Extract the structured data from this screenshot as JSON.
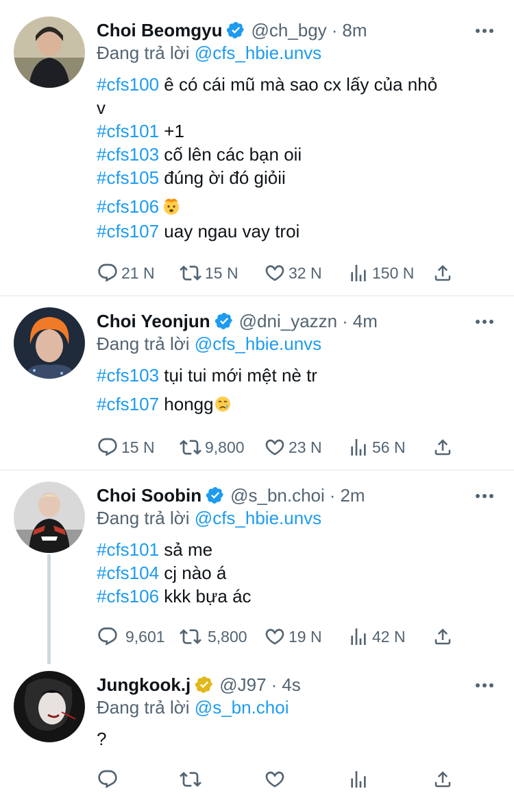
{
  "tweets": [
    {
      "name": "Choi Beomgyu",
      "handle": "@ch_bgy",
      "dot": "·",
      "time": "8m",
      "badge_color": "#1d9bf0",
      "reply_prefix": "Đang trả lời",
      "reply_mention": "@cfs_hbie.unvs",
      "lines": [
        {
          "tag": "#cfs100",
          "text": " ê có cái mũ mà sao cx lấy của nhỏ"
        },
        {
          "tag": "",
          "text": "v"
        },
        {
          "tag": "#cfs101",
          "text": " +1"
        },
        {
          "tag": "#cfs103",
          "text": " cố lên các bạn oii"
        },
        {
          "tag": "#cfs105",
          "text": " đúng ời đó giỏii"
        },
        {
          "tag": "#cfs106",
          "text": "",
          "emoji": "exploding-head-emoji"
        },
        {
          "tag": "#cfs107",
          "text": " uay ngau vay troi"
        }
      ],
      "counts": {
        "reply": "21 N",
        "retweet": "15 N",
        "like": "32 N",
        "views": "150 N"
      }
    },
    {
      "name": "Choi Yeonjun",
      "handle": "@dni_yazzn",
      "dot": "·",
      "time": "4m",
      "badge_color": "#1d9bf0",
      "reply_prefix": "Đang trả lời",
      "reply_mention": "@cfs_hbie.unvs",
      "lines": [
        {
          "tag": "#cfs103",
          "text": " tụi tui mới mệt nè tr"
        },
        {
          "tag": "#cfs107",
          "text": " hongg",
          "emoji": "crying-face-emoji"
        }
      ],
      "counts": {
        "reply": "15 N",
        "retweet": "9,800",
        "like": "23 N",
        "views": "56 N"
      }
    },
    {
      "name": "Choi Soobin",
      "handle": "@s_bn.choi",
      "dot": "·",
      "time": "2m",
      "badge_color": "#1d9bf0",
      "reply_prefix": "Đang trả lời",
      "reply_mention": "@cfs_hbie.unvs",
      "lines": [
        {
          "tag": "#cfs101",
          "text": " sả me"
        },
        {
          "tag": "#cfs104",
          "text": " cj nào á"
        },
        {
          "tag": "#cfs106",
          "text": " kkk bựa ác"
        }
      ],
      "counts": {
        "reply": "9,601",
        "retweet": "5,800",
        "like": "19 N",
        "views": "42 N"
      }
    },
    {
      "name": "Jungkook.j",
      "handle": "@J97",
      "dot": "·",
      "time": "4s",
      "badge_color": "#e2b719",
      "reply_prefix": "Đang trả lời",
      "reply_mention": "@s_bn.choi",
      "lines": [
        {
          "tag": "",
          "text": "?"
        }
      ],
      "counts": {
        "reply": "",
        "retweet": "",
        "like": "",
        "views": ""
      }
    }
  ]
}
